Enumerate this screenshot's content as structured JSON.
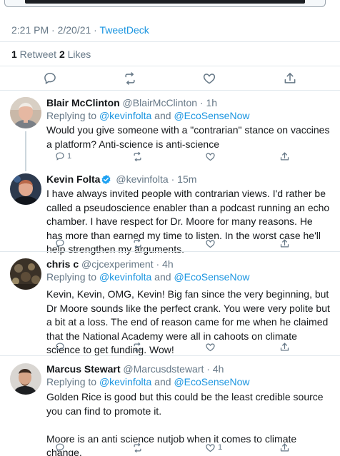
{
  "meta": {
    "time": "2:21 PM · 2/20/21 · ",
    "client": "TweetDeck"
  },
  "stats": {
    "retweets_count": "1",
    "retweets_label": " Retweet ",
    "likes_count": "2",
    "likes_label": " Likes"
  },
  "main_actions": [
    "reply-icon",
    "retweet-icon",
    "like-icon",
    "share-icon"
  ],
  "tweets": [
    {
      "name": "Blair McClinton",
      "handle": " @BlairMcClinton · 1h",
      "replying_prefix": "Replying to ",
      "mention1": "@kevinfolta",
      "replying_and": " and ",
      "mention2": "@EcoSenseNow",
      "text": "Would you give someone with a \"contrarian\" stance on vaccines a platform? Anti-science is anti-science",
      "reply_count": "1",
      "retweet_count": "",
      "like_count": ""
    },
    {
      "name": "Kevin Folta",
      "handle": " @kevinfolta · 15m",
      "verified": true,
      "text": "I have always invited people with contrarian views. I'd rather be called a pseudoscience enabler than a podcast running an echo chamber. I have respect for Dr. Moore for many reasons. He has more than earned my time to listen. In the worst case he'll help strengthen my arguments.",
      "reply_count": "",
      "retweet_count": "",
      "like_count": ""
    },
    {
      "name": "chris c",
      "handle": " @cjcexperiment · 4h",
      "replying_prefix": "Replying to ",
      "mention1": "@kevinfolta",
      "replying_and": " and ",
      "mention2": "@EcoSenseNow",
      "text": "Kevin, Kevin, OMG, Kevin! Big fan since the very beginning, but Dr Moore sounds like the perfect crank. You were very polite but a bit at a loss. The end of reason came for me when he claimed that the National Academy were all in cahoots on climate science to get funding. Wow!",
      "reply_count": "",
      "retweet_count": "",
      "like_count": ""
    },
    {
      "name": "Marcus Stewart",
      "handle": " @Marcusdstewart · 4h",
      "replying_prefix": "Replying to ",
      "mention1": "@kevinfolta",
      "replying_and": " and ",
      "mention2": "@EcoSenseNow",
      "text": "Golden Rice is good but this could be the least credible source you can find to promote it.\n\nMoore is an anti science nutjob when it comes to climate change.",
      "reply_count": "",
      "retweet_count": "",
      "like_count": "1"
    }
  ],
  "colors": {
    "link": "#1b95e0",
    "muted": "#657786",
    "text": "#14171a",
    "divider": "#e1e8ed",
    "verified": "#1da1f2"
  }
}
